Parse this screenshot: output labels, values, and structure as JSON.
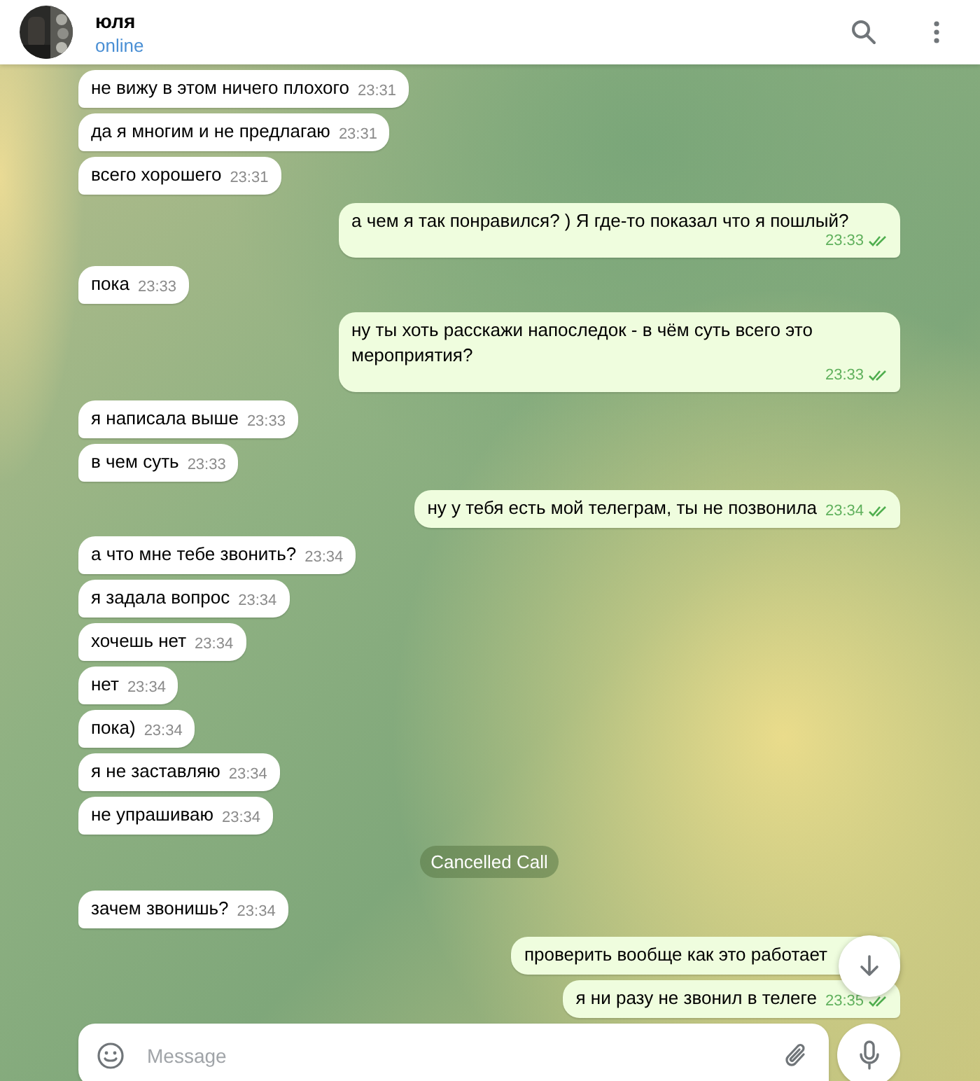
{
  "chat": {
    "name": "юля",
    "status": "online"
  },
  "messages": [
    {
      "kind": "message",
      "outgoing": false,
      "text": "не вижу в этом ничего плохого",
      "time": "23:31"
    },
    {
      "kind": "message",
      "outgoing": false,
      "text": "да я многим и не предлагаю",
      "time": "23:31"
    },
    {
      "kind": "message",
      "outgoing": false,
      "text": "всего хорошего",
      "time": "23:31"
    },
    {
      "kind": "message",
      "outgoing": true,
      "text": "а чем я так понравился? ) Я где-то показал что я пошлый?",
      "time": "23:33",
      "read": true
    },
    {
      "kind": "message",
      "outgoing": false,
      "text": "пока",
      "time": "23:33"
    },
    {
      "kind": "message",
      "outgoing": true,
      "text": "ну ты хоть расскажи напоследок - в чём суть всего это мероприятия?",
      "time": "23:33",
      "read": true
    },
    {
      "kind": "message",
      "outgoing": false,
      "text": "я написала выше",
      "time": "23:33"
    },
    {
      "kind": "message",
      "outgoing": false,
      "text": "в чем суть",
      "time": "23:33"
    },
    {
      "kind": "message",
      "outgoing": true,
      "text": "ну у тебя есть мой телеграм, ты не позвонила",
      "time": "23:34",
      "read": true
    },
    {
      "kind": "message",
      "outgoing": false,
      "text": "а что мне тебе звонить?",
      "time": "23:34"
    },
    {
      "kind": "message",
      "outgoing": false,
      "text": "я задала вопрос",
      "time": "23:34"
    },
    {
      "kind": "message",
      "outgoing": false,
      "text": "хочешь нет",
      "time": "23:34"
    },
    {
      "kind": "message",
      "outgoing": false,
      "text": "нет",
      "time": "23:34"
    },
    {
      "kind": "message",
      "outgoing": false,
      "text": "пока)",
      "time": "23:34"
    },
    {
      "kind": "message",
      "outgoing": false,
      "text": "я не заставляю",
      "time": "23:34"
    },
    {
      "kind": "message",
      "outgoing": false,
      "text": "не упрашиваю",
      "time": "23:34"
    },
    {
      "kind": "service",
      "text": "Cancelled Call"
    },
    {
      "kind": "message",
      "outgoing": false,
      "text": "зачем звонишь?",
      "time": "23:34"
    },
    {
      "kind": "message",
      "outgoing": true,
      "text": "проверить вообще как это работает"
    },
    {
      "kind": "message",
      "outgoing": true,
      "text": "я ни разу не звонил в телеге",
      "time": "23:35",
      "read": true
    }
  ],
  "composer": {
    "placeholder": "Message"
  }
}
